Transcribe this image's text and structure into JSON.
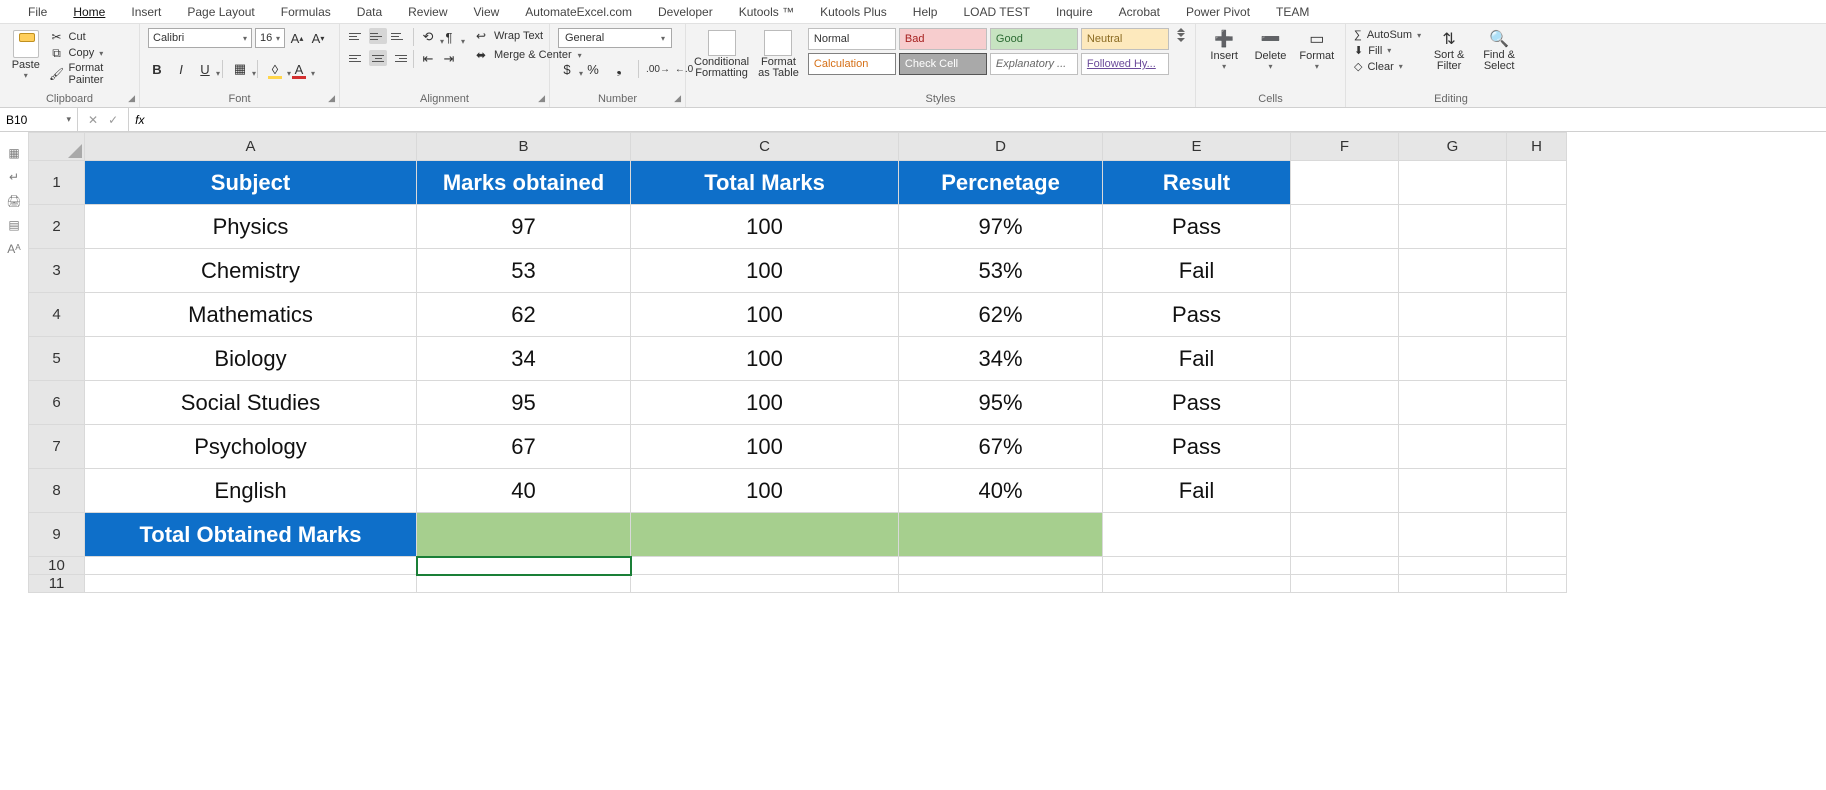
{
  "tabs": [
    "File",
    "Home",
    "Insert",
    "Page Layout",
    "Formulas",
    "Data",
    "Review",
    "View",
    "AutomateExcel.com",
    "Developer",
    "Kutools ™",
    "Kutools Plus",
    "Help",
    "LOAD TEST",
    "Inquire",
    "Acrobat",
    "Power Pivot",
    "TEAM"
  ],
  "active_tab": "Home",
  "clipboard": {
    "paste": "Paste",
    "cut": "Cut",
    "copy": "Copy",
    "format_painter": "Format Painter",
    "group": "Clipboard"
  },
  "font": {
    "name": "Calibri",
    "size": "16",
    "group": "Font"
  },
  "alignment": {
    "wrap": "Wrap Text",
    "merge": "Merge & Center",
    "group": "Alignment"
  },
  "number": {
    "format": "General",
    "group": "Number"
  },
  "styles": {
    "cond": "Conditional Formatting",
    "fmt_table": "Format as Table",
    "cells": {
      "normal": "Normal",
      "bad": "Bad",
      "good": "Good",
      "neutral": "Neutral",
      "calc": "Calculation",
      "check": "Check Cell",
      "expl": "Explanatory ...",
      "link": "Followed Hy..."
    },
    "group": "Styles"
  },
  "cells": {
    "insert": "Insert",
    "delete": "Delete",
    "format": "Format",
    "group": "Cells"
  },
  "editing": {
    "autosum": "AutoSum",
    "fill": "Fill",
    "clear": "Clear",
    "sort": "Sort & Filter",
    "find": "Find & Select",
    "group": "Editing"
  },
  "name_box": "B10",
  "columns": [
    "A",
    "B",
    "C",
    "D",
    "E",
    "F",
    "G",
    "H"
  ],
  "header_row": [
    "Subject",
    "Marks obtained",
    "Total Marks",
    "Percnetage",
    "Result"
  ],
  "rows": [
    {
      "subject": "Physics",
      "marks": "97",
      "total": "100",
      "pct": "97%",
      "result": "Pass"
    },
    {
      "subject": "Chemistry",
      "marks": "53",
      "total": "100",
      "pct": "53%",
      "result": "Fail"
    },
    {
      "subject": "Mathematics",
      "marks": "62",
      "total": "100",
      "pct": "62%",
      "result": "Pass"
    },
    {
      "subject": "Biology",
      "marks": "34",
      "total": "100",
      "pct": "34%",
      "result": "Fail"
    },
    {
      "subject": "Social Studies",
      "marks": "95",
      "total": "100",
      "pct": "95%",
      "result": "Pass"
    },
    {
      "subject": "Psychology",
      "marks": "67",
      "total": "100",
      "pct": "67%",
      "result": "Pass"
    },
    {
      "subject": "English",
      "marks": "40",
      "total": "100",
      "pct": "40%",
      "result": "Fail"
    }
  ],
  "total_label": "Total Obtained Marks"
}
